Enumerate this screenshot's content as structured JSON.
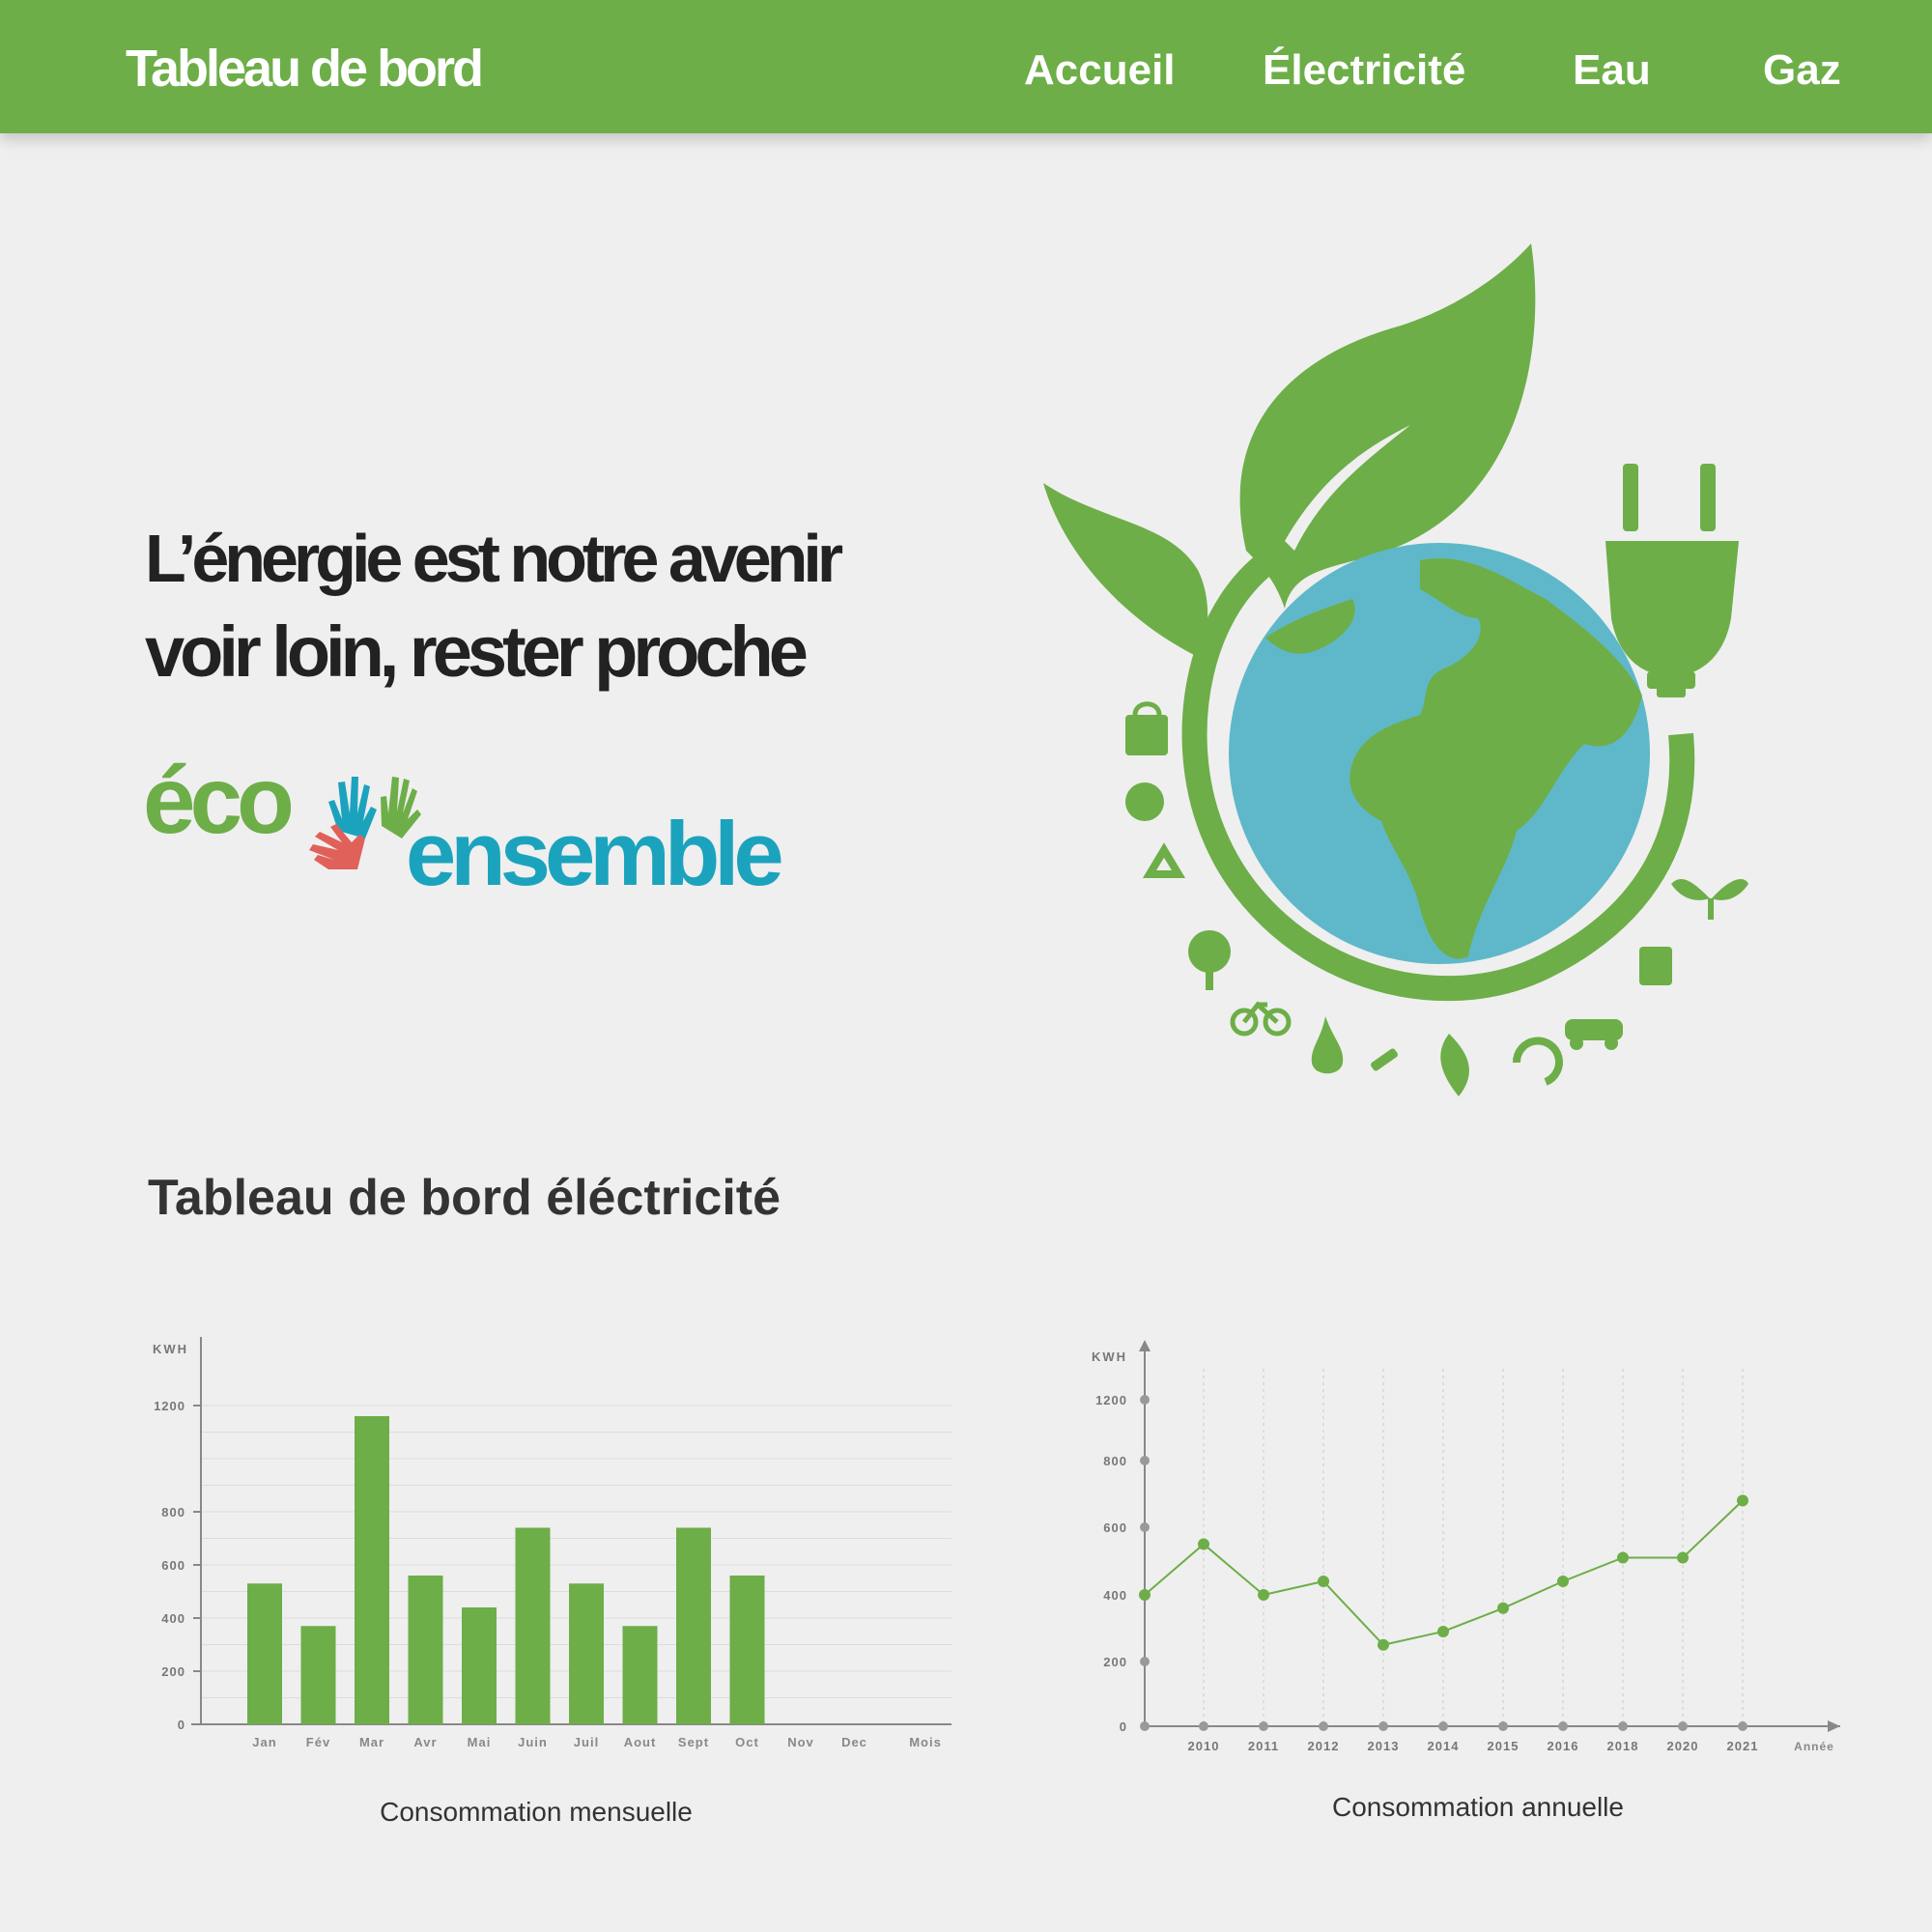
{
  "header": {
    "brand": "Tableau de bord",
    "nav": [
      {
        "label": "Accueil"
      },
      {
        "label": "Électricité"
      },
      {
        "label": "Eau"
      },
      {
        "label": "Gaz"
      }
    ]
  },
  "hero": {
    "line1": "L’énergie  est notre avenir",
    "line2": "voir loin, rester proche",
    "logo": {
      "eco": "éco",
      "ensemble": "ensemble"
    }
  },
  "section": {
    "title": "Tableau de bord éléctricité"
  },
  "colors": {
    "brand_green": "#6dae48",
    "accent_blue": "#1ba3bd",
    "globe_blue": "#5fb8c9",
    "hand_red": "#e0605a"
  },
  "chart_data": [
    {
      "type": "bar",
      "ylabel": "KWH",
      "xlabel": "Mois",
      "caption": "Consommation mensuelle",
      "yticks": [
        0,
        200,
        400,
        600,
        800,
        1200
      ],
      "categories": [
        "Jan",
        "Fév",
        "Mar",
        "Avr",
        "Mai",
        "Juin",
        "Juil",
        "Aout",
        "Sept",
        "Oct",
        "Nov",
        "Dec"
      ],
      "values": [
        530,
        370,
        1160,
        560,
        440,
        740,
        530,
        370,
        740,
        560,
        null,
        null
      ],
      "ylim": [
        0,
        1200
      ],
      "grid": true
    },
    {
      "type": "line",
      "ylabel": "KWH",
      "xlabel": "Année",
      "caption": "Consommation annuelle",
      "yticks": [
        0,
        200,
        400,
        600,
        800,
        1200
      ],
      "x": [
        "2010",
        "2011",
        "2012",
        "2013",
        "2014",
        "2015",
        "2016",
        "2018",
        "2020",
        "2021"
      ],
      "values": [
        550,
        400,
        440,
        250,
        290,
        360,
        440,
        510,
        510,
        680
      ],
      "start_value": 400,
      "ylim": [
        0,
        1200
      ],
      "grid": true
    }
  ]
}
